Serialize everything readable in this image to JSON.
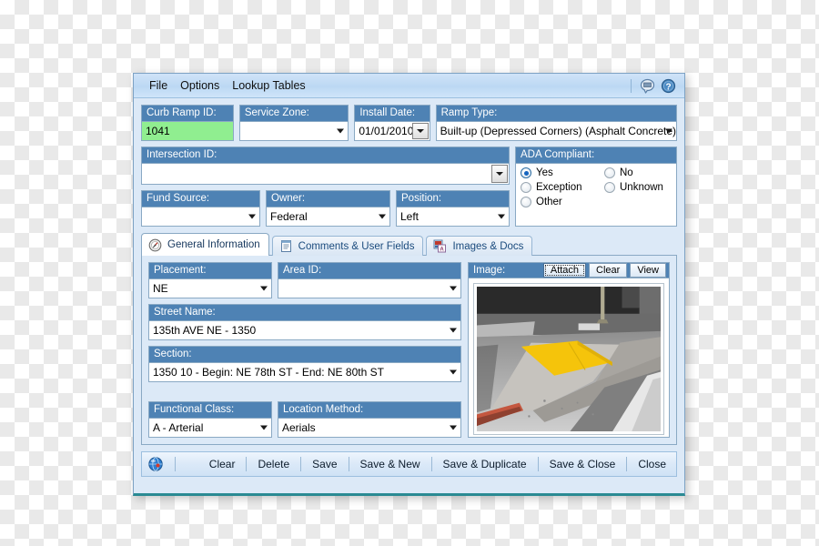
{
  "menu": {
    "items": [
      "File",
      "Options",
      "Lookup Tables"
    ],
    "comment_icon": "speech-bubble-icon",
    "help_icon": "help-question-icon"
  },
  "top_fields": {
    "curb_ramp_id": {
      "label": "Curb Ramp ID:",
      "value": "1041"
    },
    "service_zone": {
      "label": "Service Zone:",
      "value": ""
    },
    "install_date": {
      "label": "Install Date:",
      "value": "01/01/2010"
    },
    "ramp_type": {
      "label": "Ramp Type:",
      "value": "Built-up (Depressed Corners) (Asphalt Concrete)"
    },
    "intersection_id": {
      "label": "Intersection ID:",
      "value": ""
    },
    "fund_source": {
      "label": "Fund Source:",
      "value": ""
    },
    "owner": {
      "label": "Owner:",
      "value": "Federal"
    },
    "position": {
      "label": "Position:",
      "value": "Left"
    }
  },
  "ada_group": {
    "label": "ADA Compliant:",
    "options": [
      {
        "label": "Yes",
        "selected": true
      },
      {
        "label": "No",
        "selected": false
      },
      {
        "label": "Exception",
        "selected": false
      },
      {
        "label": "Unknown",
        "selected": false
      },
      {
        "label": "Other",
        "selected": false
      }
    ]
  },
  "tabs": [
    {
      "label": "General Information",
      "icon": "compass-icon",
      "active": true
    },
    {
      "label": "Comments & User Fields",
      "icon": "document-lines-icon",
      "active": false
    },
    {
      "label": "Images & Docs",
      "icon": "image-pdf-icon",
      "active": false
    }
  ],
  "general_information": {
    "placement": {
      "label": "Placement:",
      "value": "NE"
    },
    "area_id": {
      "label": "Area ID:",
      "value": ""
    },
    "street_name": {
      "label": "Street Name:",
      "value": "135th AVE NE - 1350"
    },
    "section": {
      "label": "Section:",
      "value": "1350  10  -  Begin: NE 78th ST  -  End: NE 80th ST"
    },
    "functional_class": {
      "label": "Functional Class:",
      "value": "A - Arterial"
    },
    "location_method": {
      "label": "Location Method:",
      "value": "Aerials"
    }
  },
  "image_panel": {
    "label": "Image:",
    "attach_button": "Attach",
    "clear_button": "Clear",
    "view_button": "View",
    "photo_alt": "curb-ramp-photo-yellow-detectable-warning-pad"
  },
  "bottom_bar": {
    "globe_icon": "globe-icon",
    "buttons": [
      "Clear",
      "Delete",
      "Save",
      "Save & New",
      "Save & Duplicate",
      "Save & Close",
      "Close"
    ]
  },
  "colors": {
    "caption_blue": "#4e82b4",
    "window_bg": "#dce9f7",
    "highlight_green": "#90ee90",
    "tab_text": "#1b4b7d",
    "bottom_accent": "#2a8a93"
  }
}
